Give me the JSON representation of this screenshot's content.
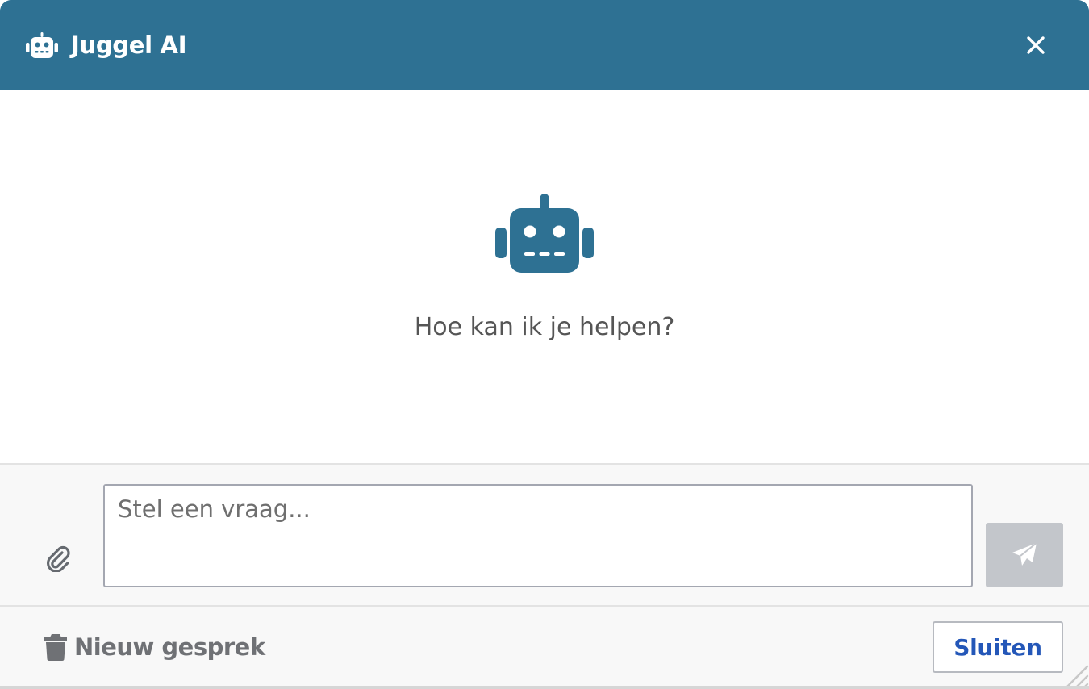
{
  "header": {
    "title": "Juggel AI",
    "icon": "robot-icon",
    "close_icon": "close-icon",
    "background": "#2e7193"
  },
  "main": {
    "icon": "robot-icon",
    "greeting": "Hoe kan ik je helpen?"
  },
  "composer": {
    "attach_icon": "paperclip-icon",
    "input_placeholder": "Stel een vraag...",
    "input_value": "",
    "send_icon": "paper-plane-icon"
  },
  "footer": {
    "new_chat_icon": "trash-icon",
    "new_chat_label": "Nieuw gesprek",
    "close_label": "Sluiten"
  },
  "colors": {
    "accent": "#2e7193",
    "link_blue": "#2457b8",
    "send_disabled": "#c3c6cb"
  }
}
